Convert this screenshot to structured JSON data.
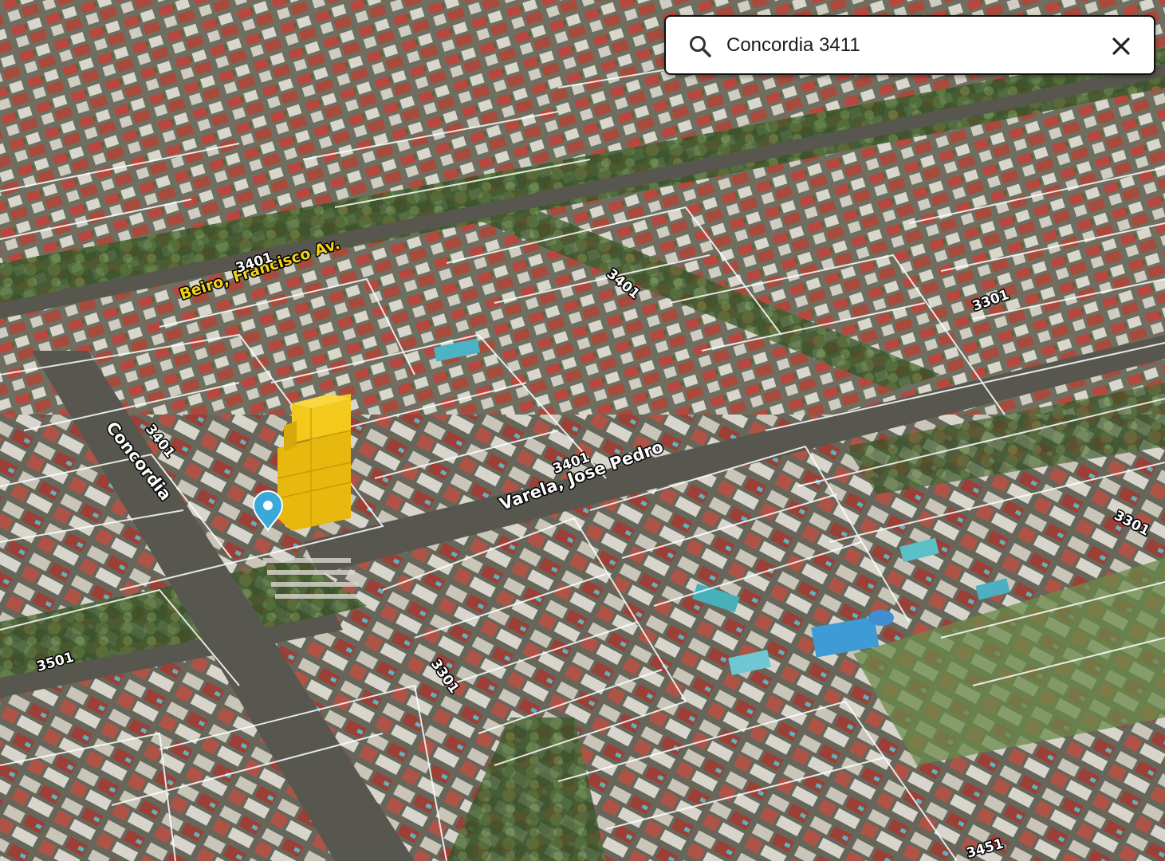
{
  "search": {
    "value": "Concordia 3411",
    "placeholder": "",
    "search_icon": "search-icon",
    "clear_icon": "close-icon"
  },
  "map": {
    "view": "3D aerial",
    "highlight_color": "#f0c414",
    "marker_color": "#3aa8d8",
    "street_labels": [
      {
        "text": "Beiro, Francisco Av.",
        "kind": "primary"
      },
      {
        "text": "3401",
        "kind": "number"
      },
      {
        "text": "Concordia",
        "kind": "name"
      },
      {
        "text": "3401",
        "kind": "number"
      },
      {
        "text": "Varela, Jose Pedro",
        "kind": "name"
      },
      {
        "text": "3401",
        "kind": "number"
      },
      {
        "text": "3401",
        "kind": "number"
      },
      {
        "text": "3301",
        "kind": "number"
      },
      {
        "text": "3301",
        "kind": "number"
      },
      {
        "text": "3501",
        "kind": "number"
      },
      {
        "text": "3301",
        "kind": "number"
      },
      {
        "text": "3451",
        "kind": "number"
      }
    ]
  }
}
